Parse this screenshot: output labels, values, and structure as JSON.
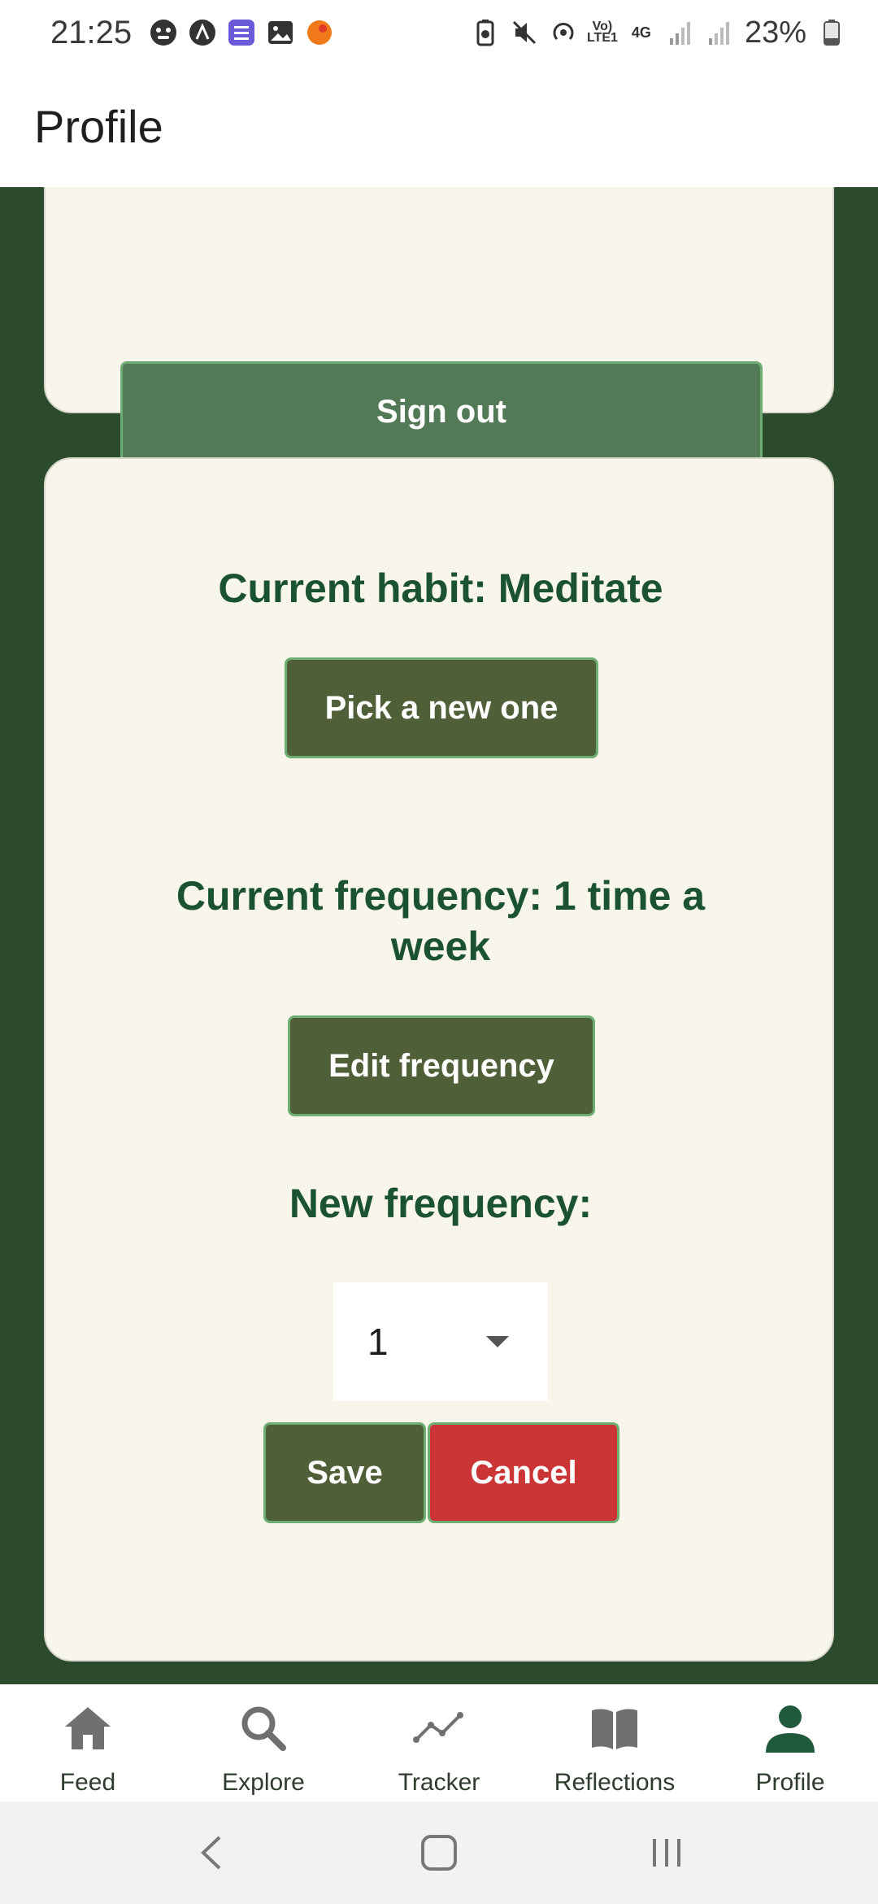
{
  "status_bar": {
    "time": "21:25",
    "battery": "23%",
    "network_label": "4G"
  },
  "header": {
    "title": "Profile"
  },
  "account_card": {
    "sign_out_label": "Sign out"
  },
  "habit_card": {
    "current_habit": "Current habit: Meditate",
    "pick_new_label": "Pick a new one",
    "current_frequency": "Current frequency: 1 time a week",
    "edit_frequency_label": "Edit frequency",
    "new_frequency_label": "New frequency:",
    "frequency_value": "1",
    "save_label": "Save",
    "cancel_label": "Cancel"
  },
  "bottom_nav": {
    "items": [
      {
        "label": "Feed",
        "icon": "home-icon"
      },
      {
        "label": "Explore",
        "icon": "search-icon"
      },
      {
        "label": "Tracker",
        "icon": "trend-line-icon"
      },
      {
        "label": "Reflections",
        "icon": "book-icon"
      },
      {
        "label": "Profile",
        "icon": "person-icon",
        "active": true
      }
    ]
  },
  "colors": {
    "background": "#2c4b2c",
    "card": "#f8f5ea",
    "heading": "#1b5331",
    "button_dark": "#4f5f38",
    "button_signout": "#527a56",
    "button_cancel": "#cc3536",
    "nav_active": "#1f5a3a"
  }
}
